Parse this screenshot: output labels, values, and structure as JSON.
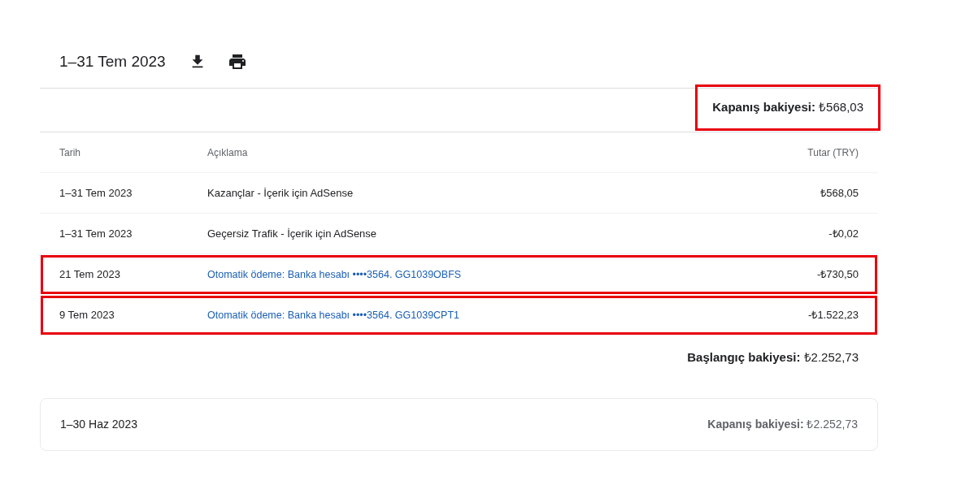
{
  "statement": {
    "period": "1–31 Tem 2023",
    "closing_balance": {
      "text": "**Kapanış bakiyesi:** ₺568,03",
      "highlighted": true
    },
    "columns": [
      "Tarih",
      "Açıklama",
      "Tutar (TRY)"
    ],
    "rows": [
      {
        "date": "1–31 Tem 2023",
        "description": "Kazançlar - İçerik için AdSense",
        "kind": "text",
        "amount": "₺568,05",
        "highlighted": false
      },
      {
        "date": "1–31 Tem 2023",
        "description": "Geçersiz Trafik - İçerik için AdSense",
        "kind": "text",
        "amount": "-₺0,02",
        "highlighted": false
      },
      {
        "date": "21 Tem 2023",
        "description": "Otomatik ödeme: Banka hesabı ••••3564. GG1039OBFS",
        "kind": "link",
        "amount": "-₺730,50",
        "highlighted": true
      },
      {
        "date": "9 Tem 2023",
        "description": "Otomatik ödeme: Banka hesabı ••••3564. GG1039CPT1",
        "kind": "link",
        "amount": "-₺1.522,23",
        "highlighted": true
      }
    ],
    "opening_balance": "**Başlangıç bakiyesi:** ₺2.252,73"
  },
  "previous_period": {
    "period": "1–30 Haz 2023",
    "closing_balance": "**Kapanış bakiyesi:** ₺2.252,73"
  }
}
